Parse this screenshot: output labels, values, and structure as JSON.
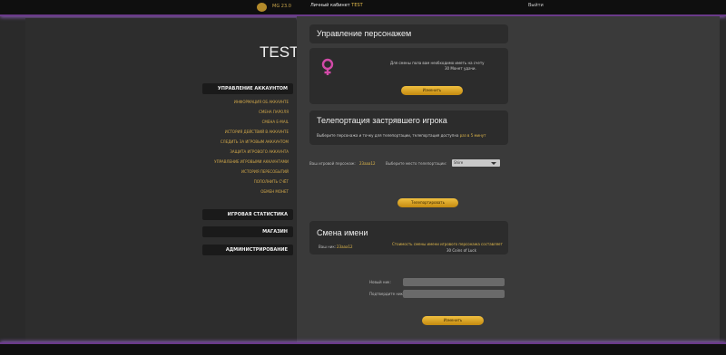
{
  "topbar": {
    "balance": "MG 23.0",
    "account_prefix": "Личный кабинет",
    "account_name": "TEST",
    "logout": "Выйти"
  },
  "sidebar": {
    "title": "TEST",
    "manage_head": "УПРАВЛЕНИЕ АККАУНТОМ",
    "links": [
      "ИНФОРМАЦИЯ ОБ АККАУНТЕ",
      "СМЕНА ПАРОЛЯ",
      "СМЕНА E-MAIL",
      "ИСТОРИЯ ДЕЙСТВИЙ В АККАУНТЕ",
      "СЛЕДИТЬ ЗА ИГРОВЫМ АККАУНТОМ",
      "ЗАЩИТА ИГРОВОГО АККАУНТА",
      "УПРАВЛЕНИЕ ИГРОВЫМИ АККАУНТАМИ",
      "ИСТОРИЯ ПЕРЕСОБЫТИЙ",
      "ПОПОЛНИТЬ СЧЁТ",
      "ОБМЕН МОНЕТ"
    ],
    "stats_head": "ИГРОВАЯ СТАТИСТИКА",
    "shop_head": "МАГАЗИН",
    "admin_head": "АДМИНИСТРИРОВАНИЕ"
  },
  "char_manage": {
    "title": "Управление персонажем",
    "desc_line1": "Для смены пола вам необходимо иметь на счету",
    "desc_line2": "30 Монет удачи.",
    "button": "Изменить"
  },
  "teleport": {
    "title": "Телепортация застрявшего игрока",
    "desc_prefix": "Выберите персонажа и точку для телепортации, телепортация доступна",
    "desc_hl": "раз в 5 минут",
    "char_label": "Ваш игровой персонаж:",
    "char_value": "23aaa12",
    "place_label": "Выберите место телепортации:",
    "place_value": "Shire",
    "button": "Телепортировать"
  },
  "rename": {
    "title": "Смена имени",
    "char_label": "Ваш ник:",
    "char_value": "23aaa12",
    "cost_line1": "Стоимость смены имени игрового персонажа составляет",
    "cost_line2": "30 Coins of Luck",
    "new_name_label": "Новый ник:",
    "confirm_label": "Подтвердите ник:",
    "button": "Изменить"
  }
}
